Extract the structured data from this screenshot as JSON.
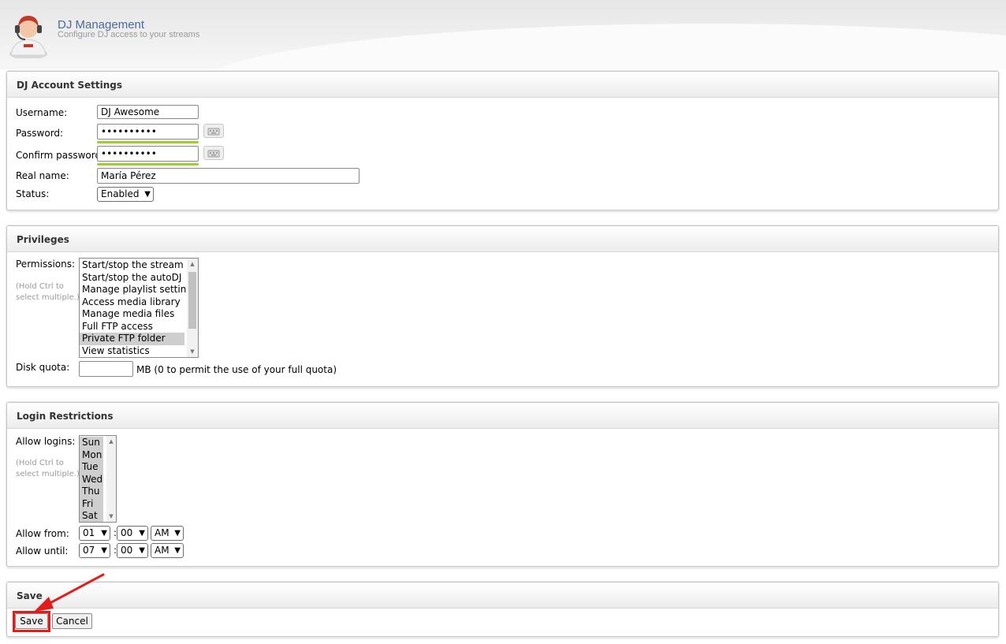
{
  "header": {
    "title": "DJ Management",
    "subtitle": "Configure DJ access to your streams",
    "avatar_icon": "dj-headset-avatar-icon"
  },
  "account": {
    "heading": "DJ Account Settings",
    "username_label": "Username:",
    "username_value": "DJ Awesome",
    "password_label": "Password:",
    "password_value": "••••••••••",
    "confirm_label": "Confirm password:",
    "confirm_value": "••••••••••",
    "realname_label": "Real name:",
    "realname_value": "María Pérez",
    "status_label": "Status:",
    "status_value": "Enabled",
    "strength_color": "#9bd22a"
  },
  "privileges": {
    "heading": "Privileges",
    "permissions_label": "Permissions:",
    "hint_line1": "(Hold Ctrl to",
    "hint_line2": "select multiple.)",
    "options": [
      "Start/stop the stream",
      "Start/stop the autoDJ",
      "Manage playlist settings",
      "Access media library",
      "Manage media files",
      "Full FTP access",
      "Private FTP folder",
      "View statistics"
    ],
    "selected_option": "Private FTP folder",
    "quota_label": "Disk quota:",
    "quota_value": "",
    "quota_note": "MB (0 to permit the use of your full quota)"
  },
  "login": {
    "heading": "Login Restrictions",
    "allow_label": "Allow logins:",
    "hint_line1": "(Hold Ctrl to",
    "hint_line2": "select multiple.)",
    "days": [
      "Sun",
      "Mon",
      "Tue",
      "Wed",
      "Thu",
      "Fri",
      "Sat"
    ],
    "from_label": "Allow from:",
    "from_hour": "01",
    "from_minute": "00",
    "from_ampm": "AM",
    "until_label": "Allow until:",
    "until_hour": "07",
    "until_minute": "00",
    "until_ampm": "AM",
    "colon": ":"
  },
  "save": {
    "heading": "Save",
    "save_label": "Save",
    "cancel_label": "Cancel",
    "highlight_color": "#e41b1b"
  }
}
